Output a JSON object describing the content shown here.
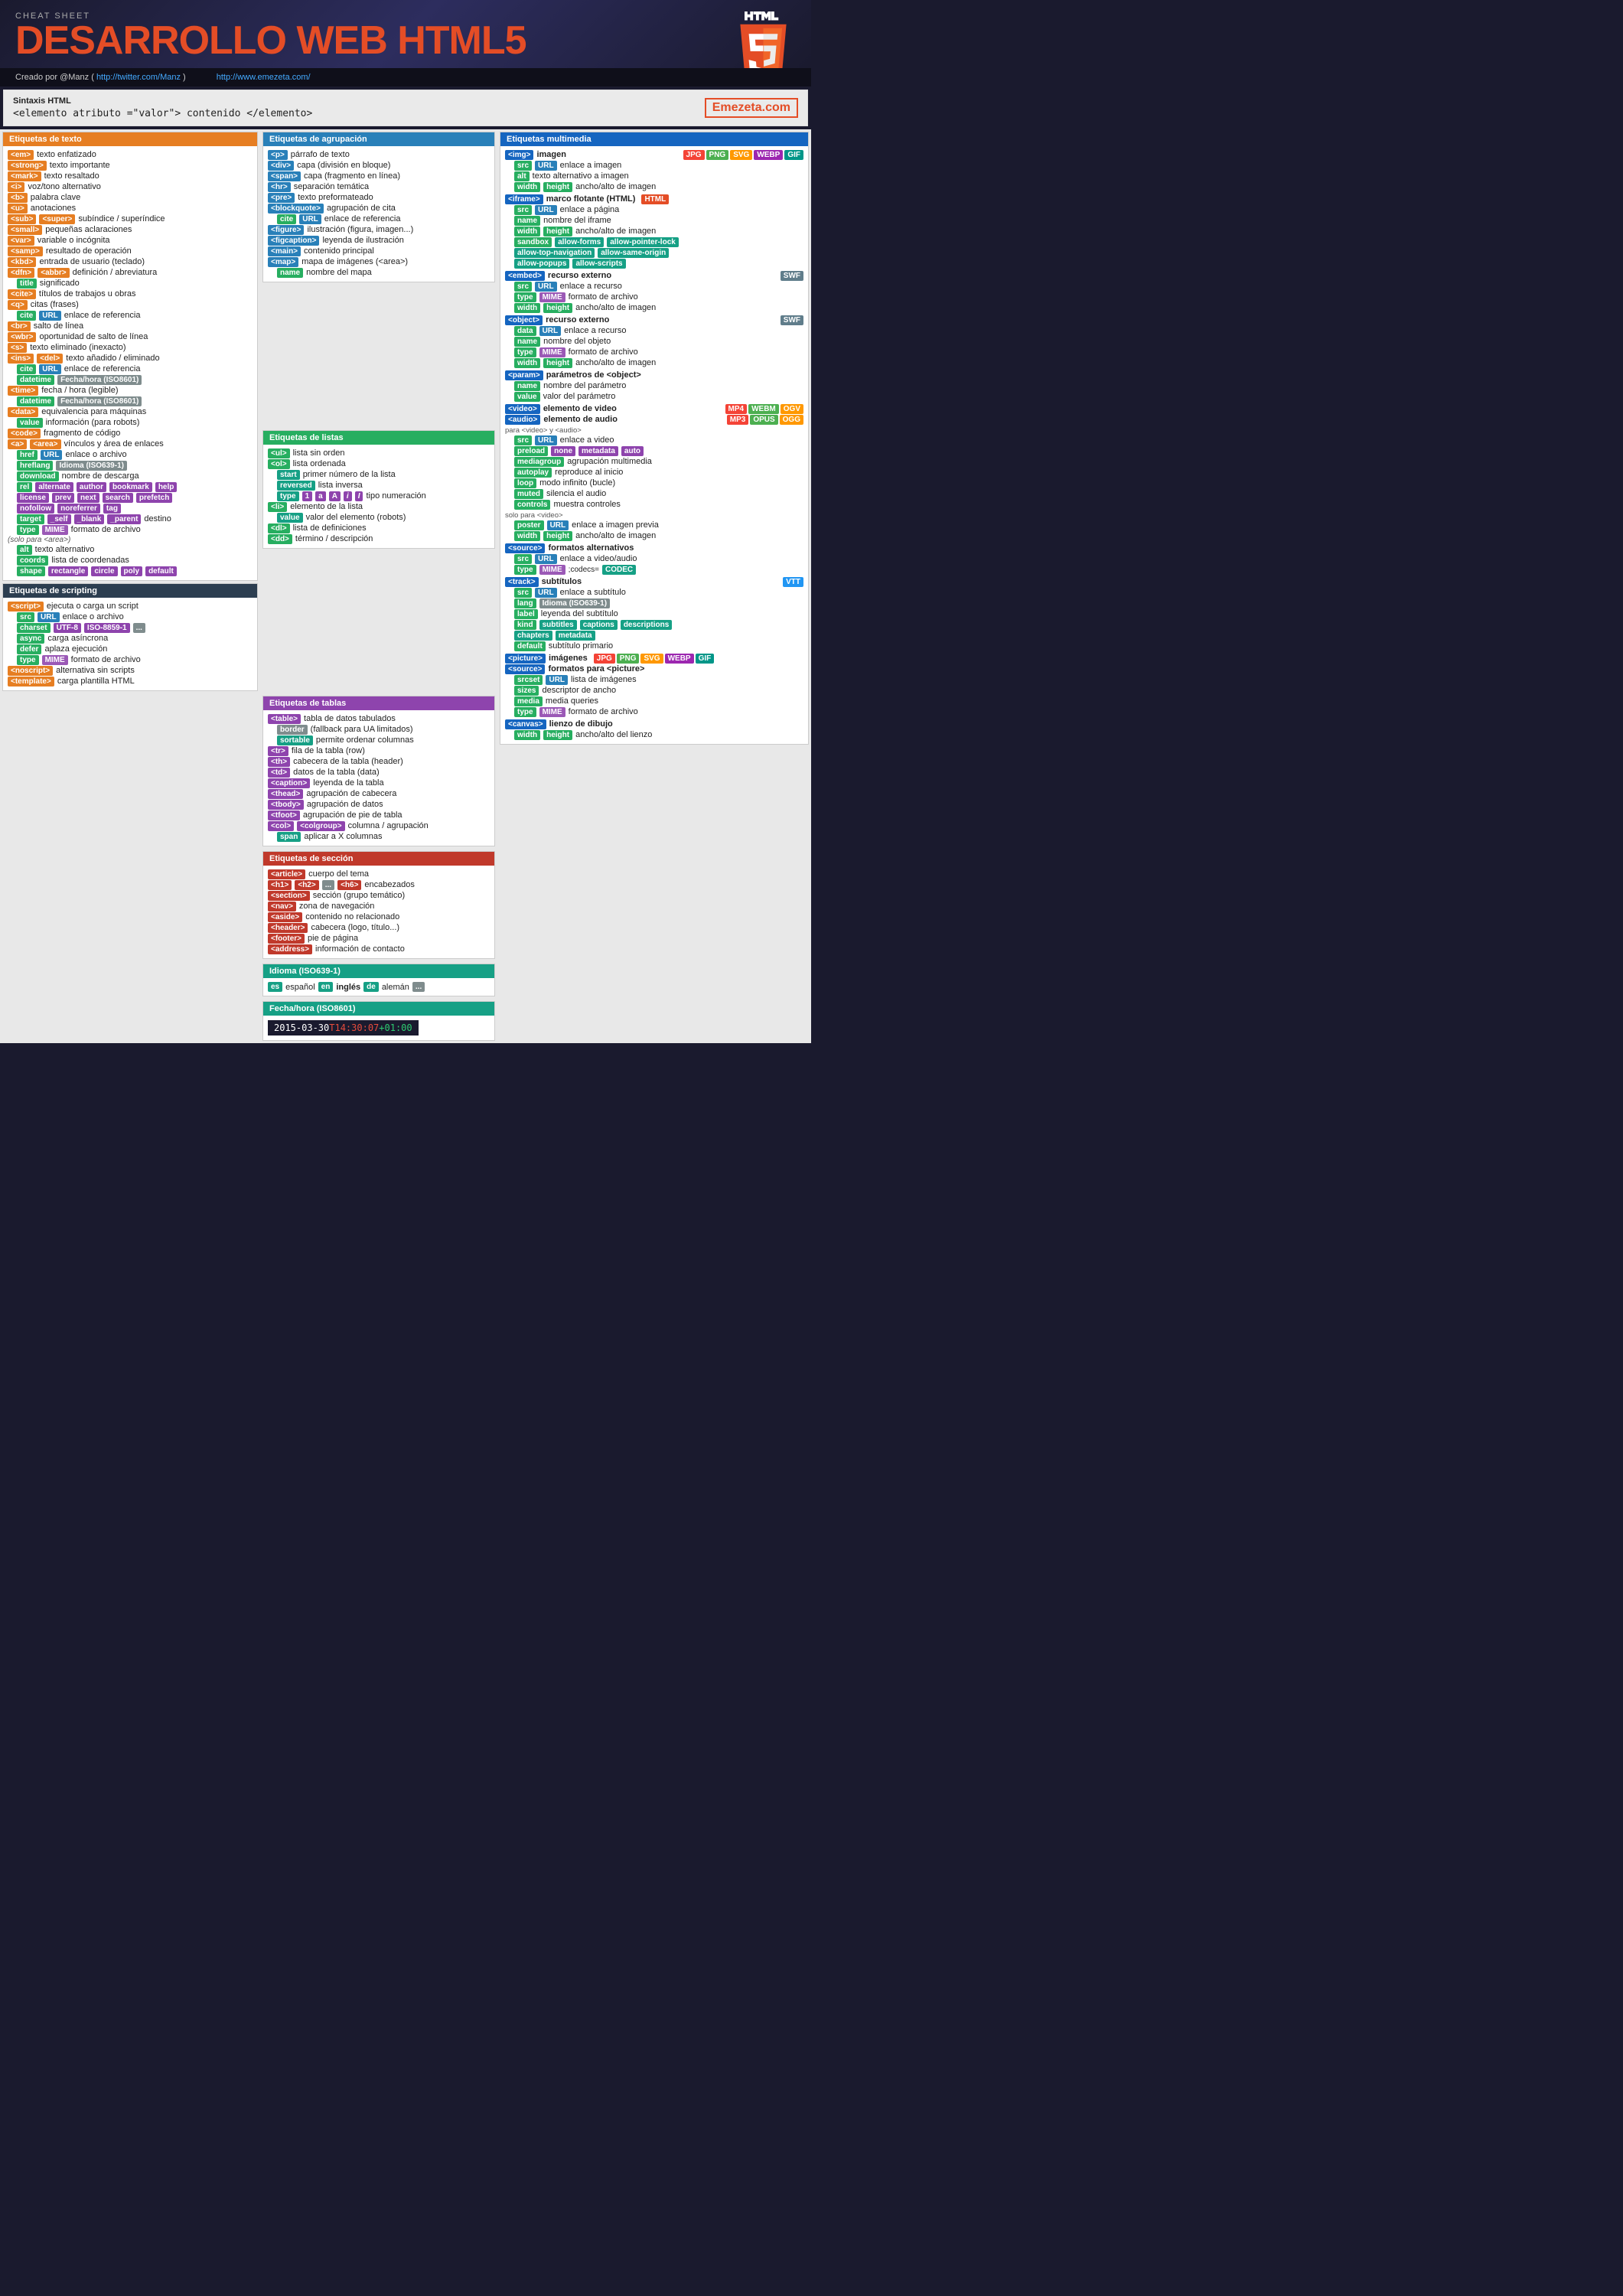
{
  "header": {
    "cheatsheet_label": "CHEAT SHEET",
    "title_part1": "DESARROLLO WEB ",
    "title_part2": "HTML5",
    "credit_label": "Creado por @Manz ( ",
    "credit_url": "http://twitter.com/Manz",
    "credit_end": " )",
    "site_url": "http://www.emezeta.com/"
  },
  "syntax": {
    "title": "Sintaxis HTML",
    "code": "<elemento  atributo =\"valor\"> contenido </elemento>",
    "logo": "Emezeta.com"
  },
  "etiquetas_texto": {
    "title": "Etiquetas de texto",
    "items": [
      {
        "tag": "<em>",
        "desc": "texto enfatizado"
      },
      {
        "tag": "<strong>",
        "desc": "texto importante"
      },
      {
        "tag": "<mark>",
        "desc": "texto resaltado"
      },
      {
        "tag": "<i>",
        "desc": "voz/tono alternativo"
      },
      {
        "tag": "<b>",
        "desc": "palabra clave"
      },
      {
        "tag": "<u>",
        "desc": "anotaciones"
      },
      {
        "tag_sub": "<sub>",
        "tag_sup": "<super>",
        "desc": "subíndice / superíndice"
      },
      {
        "tag": "<small>",
        "desc": "pequeñas aclaraciones"
      },
      {
        "tag": "<var>",
        "desc": "variable o incógnita"
      },
      {
        "tag": "<samp>",
        "desc": "resultado de operación"
      },
      {
        "tag": "<kbd>",
        "desc": "entrada de usuario (teclado)"
      },
      {
        "tag_dfn": "<dfn>",
        "tag_abbr": "<abbr>",
        "desc": "definición / abreviatura"
      },
      {
        "attr": "title",
        "desc": "significado"
      },
      {
        "tag": "<cite>",
        "desc": "títulos de trabajos u obras"
      },
      {
        "tag": "<q>",
        "desc": "citas (frases)"
      },
      {
        "attr": "cite",
        "attr2": "URL",
        "desc": "enlace de referencia"
      },
      {
        "tag": "<br>",
        "desc": "salto de línea"
      },
      {
        "tag": "<wbr>",
        "desc": "oportunidad de salto de línea"
      },
      {
        "tag": "<s>",
        "desc": "texto eliminado (inexacto)"
      },
      {
        "tag_ins": "<ins>",
        "tag_del": "<del>",
        "desc": "texto añadido / eliminado"
      },
      {
        "attr": "cite",
        "attr2": "URL",
        "desc": "enlace de referencia"
      },
      {
        "attr": "datetime",
        "attr2": "Fecha/hora (ISO8601)"
      },
      {
        "tag": "<time>",
        "desc": "fecha / hora (legible)"
      },
      {
        "attr": "datetime",
        "attr2": "Fecha/hora (ISO8601)"
      },
      {
        "tag": "<data>",
        "desc": "equivalencia para máquinas"
      },
      {
        "attr": "value",
        "desc": "información (para robots)"
      },
      {
        "tag": "<code>",
        "desc": "fragmento de código"
      },
      {
        "tag_a": "<a>",
        "tag_area": "<area>",
        "desc": "vínculos y área de enlaces"
      },
      {
        "attr": "href",
        "attr2": "URL",
        "desc": "enlace o archivo"
      },
      {
        "attr": "hreflang",
        "attr2": "Idioma (ISO639-1)"
      },
      {
        "attr": "download",
        "desc": "nombre de descarga"
      },
      {
        "attr_rel": "rel",
        "vals": [
          "alternate",
          "author",
          "bookmark",
          "help",
          "license",
          "prev",
          "next",
          "search",
          "prefetch",
          "nofollow",
          "noreferrer",
          "tag"
        ]
      },
      {
        "attr_target": "target",
        "vals": [
          "_self",
          "_blank",
          "_parent"
        ],
        "desc": "destino"
      },
      {
        "attr": "type",
        "attr2": "MIME",
        "desc": "formato de archivo"
      },
      {
        "note": "(solo para <area>)"
      },
      {
        "attr": "alt",
        "desc": "texto alternativo"
      },
      {
        "attr": "coords",
        "desc": "lista de coordenadas"
      },
      {
        "attr": "shape",
        "vals": [
          "rectangle",
          "circle",
          "poly",
          "default"
        ]
      }
    ]
  },
  "etiquetas_agrupacion": {
    "title": "Etiquetas de agrupación",
    "items": [
      {
        "tag": "<p>",
        "desc": "párrafo de texto"
      },
      {
        "tag": "<div>",
        "desc": "capa (división en bloque)"
      },
      {
        "tag": "<span>",
        "desc": "capa (fragmento en línea)"
      },
      {
        "tag": "<hr>",
        "desc": "separación temática"
      },
      {
        "tag": "<pre>",
        "desc": "texto preformateado"
      },
      {
        "tag": "<blockquote>",
        "desc": "agrupación de cita"
      },
      {
        "attr": "cite",
        "attr2": "URL",
        "desc": "enlace de referencia"
      },
      {
        "tag": "<figure>",
        "desc": "ilustración (figura, imagen...)"
      },
      {
        "tag": "<figcaption>",
        "desc": "leyenda de ilustración"
      },
      {
        "tag": "<main>",
        "desc": "contenido principal"
      },
      {
        "tag": "<map>",
        "desc": "mapa de imágenes (<area>)"
      },
      {
        "attr": "name",
        "desc": "nombre del mapa"
      }
    ]
  },
  "etiquetas_listas": {
    "title": "Etiquetas de listas",
    "items": [
      {
        "tag": "<ul>",
        "desc": "lista sin orden"
      },
      {
        "tag": "<ol>",
        "desc": "lista ordenada"
      },
      {
        "attr": "start",
        "desc": "primer número de la lista"
      },
      {
        "attr": "reversed",
        "desc": "lista inversa"
      },
      {
        "attr": "type",
        "vals": [
          "1",
          "a",
          "A",
          "i",
          "I"
        ],
        "desc": "tipo numeración"
      },
      {
        "tag": "<li>",
        "desc": "elemento de la lista"
      },
      {
        "attr": "value",
        "desc": "valor del elemento (robots)"
      },
      {
        "tag": "<dl>",
        "desc": "lista de definiciones"
      },
      {
        "tag": "<dd>",
        "desc": "término / descripción"
      }
    ]
  },
  "etiquetas_tablas": {
    "title": "Etiquetas de tablas",
    "items": [
      {
        "tag": "<table>",
        "desc": "tabla de datos tabulados"
      },
      {
        "attr": "border",
        "desc": "(fallback para UA limitados)"
      },
      {
        "attr": "sortable",
        "desc": "permite ordenar columnas"
      },
      {
        "tag": "<tr>",
        "desc": "fila de la tabla (row)"
      },
      {
        "tag": "<th>",
        "desc": "cabecera de la tabla (header)"
      },
      {
        "tag": "<td>",
        "desc": "datos de la tabla (data)"
      },
      {
        "tag": "<caption>",
        "desc": "leyenda de la tabla"
      },
      {
        "tag": "<thead>",
        "desc": "agrupación de cabecera"
      },
      {
        "tag": "<tbody>",
        "desc": "agrupación de datos"
      },
      {
        "tag": "<tfoot>",
        "desc": "agrupación de pie de tabla"
      },
      {
        "tag_col": "<col>",
        "tag_colgroup": "<colgroup>",
        "desc": "columna / agrupación"
      },
      {
        "attr": "span",
        "desc": "aplicar a X columnas"
      }
    ]
  },
  "etiquetas_seccion": {
    "title": "Etiquetas de sección",
    "items": [
      {
        "tag": "<article>",
        "desc": "cuerpo del tema"
      },
      {
        "tags_h": [
          "<h1>",
          "<h2>",
          "...",
          "<h6>"
        ],
        "desc": "encabezados"
      },
      {
        "tag": "<section>",
        "desc": "sección (grupo temático)"
      },
      {
        "tag": "<nav>",
        "desc": "zona de navegación"
      },
      {
        "tag": "<aside>",
        "desc": "contenido no relacionado"
      },
      {
        "tag": "<header>",
        "desc": "cabecera (logo, título...)"
      },
      {
        "tag": "<footer>",
        "desc": "pie de página"
      },
      {
        "tag": "<address>",
        "desc": "información de contacto"
      }
    ]
  },
  "idioma": {
    "title": "Idioma (ISO639-1)",
    "es": "es",
    "es_desc": "español",
    "en": "en",
    "en_desc": "inglés",
    "de": "de",
    "de_desc": "alemán",
    "more": "..."
  },
  "fecha": {
    "title": "Fecha/hora (ISO8601)",
    "value": "2015-03-30",
    "time_red": "T14:30:07",
    "time_green": "+01:00"
  },
  "etiquetas_scripting": {
    "title": "Etiquetas de scripting",
    "items": [
      {
        "tag": "<script>",
        "desc": "ejecuta o carga un script"
      },
      {
        "attr": "src",
        "attr2": "URL",
        "desc": "enlace o archivo"
      },
      {
        "attr": "charset",
        "vals": [
          "UTF-8",
          "ISO-8859-1",
          "..."
        ]
      },
      {
        "attr": "async",
        "desc": "carga asíncrona"
      },
      {
        "attr": "defer",
        "desc": "aplaza ejecución"
      },
      {
        "attr": "type",
        "attr2": "MIME",
        "desc": "formato de archivo"
      },
      {
        "tag": "<noscript>",
        "desc": "alternativa sin scripts"
      },
      {
        "tag": "<template>",
        "desc": "carga plantilla HTML"
      }
    ]
  },
  "etiquetas_multimedia": {
    "title": "Etiquetas multimedia",
    "img": {
      "tag": "<img>",
      "desc": "imagen",
      "formats": [
        "JPG",
        "PNG",
        "SVG",
        "WEBP",
        "GIF"
      ],
      "attrs": [
        {
          "attr": "src",
          "attr2": "URL",
          "desc": "enlace a imagen"
        },
        {
          "attr": "alt",
          "desc": "texto alternativo a imagen"
        },
        {
          "attr_w": "width",
          "attr_h": "height",
          "desc": "ancho/alto de imagen"
        }
      ]
    },
    "iframe": {
      "tag": "<iframe>",
      "desc": "marco flotante (HTML)",
      "badge": "HTML",
      "attrs": [
        {
          "attr": "src",
          "attr2": "URL",
          "desc": "enlace a página"
        },
        {
          "attr": "name",
          "desc": "nombre del iframe"
        },
        {
          "attr_w": "width",
          "attr_h": "height",
          "desc": "ancho/alto de imagen"
        },
        {
          "attr": "sandbox",
          "vals": [
            "allow-forms",
            "allow-pointer-lock",
            "allow-top-navigation",
            "allow-same-origin",
            "allow-popups",
            "allow-scripts"
          ]
        }
      ]
    },
    "embed": {
      "tag": "<embed>",
      "desc": "recurso externo",
      "badge": "SWF",
      "attrs": [
        {
          "attr": "src",
          "attr2": "URL",
          "desc": "enlace a recurso"
        },
        {
          "attr": "type",
          "attr2": "MIME",
          "desc": "formato de archivo"
        },
        {
          "attr_w": "width",
          "attr_h": "height",
          "desc": "ancho/alto de imagen"
        }
      ]
    },
    "object": {
      "tag": "<object>",
      "desc": "recurso externo",
      "badge": "SWF",
      "attrs": [
        {
          "attr": "data",
          "attr2": "URL",
          "desc": "enlace a recurso"
        },
        {
          "attr": "name",
          "desc": "nombre del objeto"
        },
        {
          "attr": "type",
          "attr2": "MIME",
          "desc": "formato de archivo"
        },
        {
          "attr_w": "width",
          "attr_h": "height",
          "desc": "ancho/alto de imagen"
        }
      ]
    },
    "param": {
      "tag": "<param>",
      "desc": "parámetros de <object>",
      "attrs": [
        {
          "attr": "name",
          "desc": "nombre del parámetro"
        },
        {
          "attr": "value",
          "desc": "valor del parámetro"
        }
      ]
    },
    "video": {
      "tag": "<video>",
      "desc": "elemento de video",
      "formats": [
        "MP4",
        "WEBM",
        "OGV"
      ]
    },
    "audio": {
      "tag": "<audio>",
      "desc": "elemento de audio",
      "formats": [
        "MP3",
        "OPUS",
        "OGG"
      ]
    },
    "video_audio_attrs": {
      "label": "para <video> y <audio>",
      "attrs": [
        {
          "attr": "src",
          "attr2": "URL",
          "desc": "enlace a video"
        },
        {
          "attr": "preload",
          "vals": [
            "none",
            "metadata",
            "auto"
          ]
        },
        {
          "attr": "mediagroup",
          "desc": "agrupación multimedia"
        },
        {
          "attr": "autoplay",
          "desc": "reproduce al inicio"
        },
        {
          "attr": "loop",
          "desc": "modo infinito (bucle)"
        },
        {
          "attr": "muted",
          "desc": "silencia el audio"
        },
        {
          "attr": "controls",
          "desc": "muestra controles"
        }
      ]
    },
    "video_only": {
      "label": "solo para <video>",
      "attrs": [
        {
          "attr": "poster",
          "attr2": "URL",
          "desc": "enlace a imagen previa"
        },
        {
          "attr_w": "width",
          "attr_h": "height",
          "desc": "ancho/alto de imagen"
        }
      ]
    },
    "source": {
      "tag": "<source>",
      "desc": "formatos alternativos",
      "attrs": [
        {
          "attr": "src",
          "attr2": "URL",
          "desc": "enlace a video/audio"
        },
        {
          "attr": "type",
          "attr2": "MIME",
          "attr3": ";codecs=",
          "attr4": "CODEC"
        }
      ]
    },
    "track": {
      "tag": "<track>",
      "desc": "subtítulos",
      "badge": "VTT",
      "attrs": [
        {
          "attr": "src",
          "attr2": "URL",
          "desc": "enlace a subtítulo"
        },
        {
          "attr": "lang",
          "attr2": "Idioma (ISO639-1)"
        },
        {
          "attr": "label",
          "desc": "leyenda del subtítulo"
        },
        {
          "attr": "kind",
          "vals": [
            "subtitles",
            "captions",
            "descriptions",
            "chapters",
            "metadata"
          ]
        },
        {
          "attr": "default",
          "desc": "subtítulo primario"
        }
      ]
    },
    "picture": {
      "tag": "<picture>",
      "desc": "imágenes",
      "formats": [
        "JPG",
        "PNG",
        "SVG",
        "WEBP",
        "GIF"
      ]
    },
    "source_picture": {
      "tag": "<source>",
      "desc": "formatos para <picture>",
      "attrs": [
        {
          "attr": "srcset",
          "attr2": "URL",
          "desc": "lista de imágenes"
        },
        {
          "attr": "sizes",
          "desc": "descriptor de ancho"
        },
        {
          "attr": "media",
          "desc": "media queries"
        },
        {
          "attr": "type",
          "attr2": "MIME",
          "desc": "formato de archivo"
        }
      ]
    },
    "canvas": {
      "tag": "<canvas>",
      "desc": "lienzo de dibujo",
      "attrs": [
        {
          "attr_w": "width",
          "attr_h": "height",
          "desc": "ancho/alto del lienzo"
        }
      ]
    }
  }
}
